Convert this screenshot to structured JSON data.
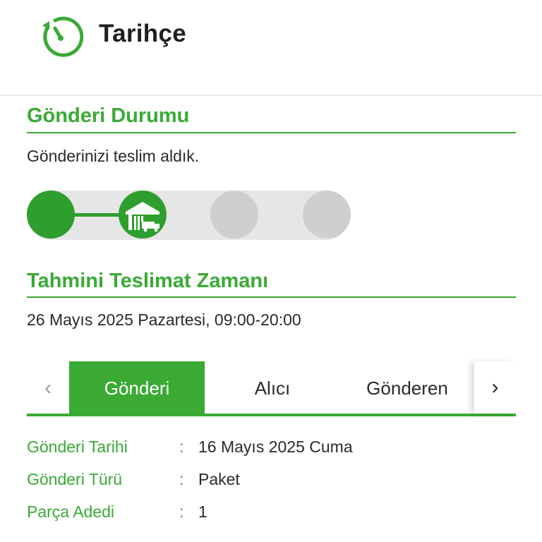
{
  "header": {
    "title": "Tarihçe",
    "icon": "history-timer-icon",
    "accent": "#3aaa35"
  },
  "status": {
    "section_title": "Gönderi Durumu",
    "message": "Gönderinizi teslim aldık.",
    "current_step": 2,
    "total_steps": 4,
    "colors": {
      "done": "#2e9e2e",
      "pending": "#cfcfcf",
      "track": "#e6e6e6"
    }
  },
  "eta": {
    "section_title": "Tahmini Teslimat Zamanı",
    "value": "26 Mayıs 2025 Pazartesi, 09:00-20:00"
  },
  "tabs": {
    "items": [
      {
        "label": "Gönderi",
        "active": true
      },
      {
        "label": "Alıcı",
        "active": false
      },
      {
        "label": "Gönderen",
        "active": false
      }
    ],
    "prev_icon": "chevron-left-icon",
    "next_icon": "chevron-right-icon"
  },
  "details": {
    "separator": ":",
    "rows": [
      {
        "label": "Gönderi Tarihi",
        "value": "16 Mayıs 2025 Cuma"
      },
      {
        "label": "Gönderi Türü",
        "value": "Paket"
      },
      {
        "label": "Parça Adedi",
        "value": "1"
      }
    ]
  }
}
